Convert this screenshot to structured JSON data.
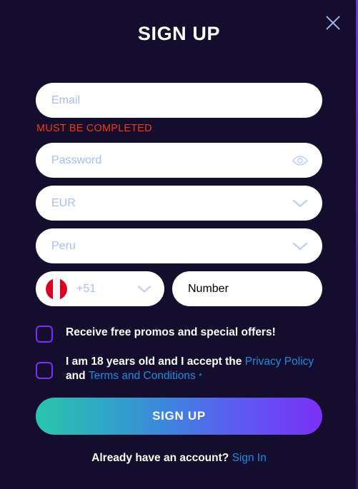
{
  "modal": {
    "title": "SIGN UP",
    "close_icon": "close-icon"
  },
  "form": {
    "email": {
      "placeholder": "Email",
      "value": "",
      "error": "MUST BE COMPLETED"
    },
    "password": {
      "placeholder": "Password",
      "value": "",
      "reveal_icon": "eye-icon"
    },
    "currency": {
      "value": "EUR",
      "chevron_icon": "chevron-down-icon"
    },
    "country": {
      "value": "Peru",
      "chevron_icon": "chevron-down-icon"
    },
    "phone": {
      "flag_icon": "peru-flag-icon",
      "dial_code": "+51",
      "chevron_icon": "chevron-down-icon",
      "number_placeholder": "Number",
      "number_value": ""
    }
  },
  "consents": {
    "promos": {
      "label": "Receive free promos and special offers!",
      "checked": false
    },
    "terms": {
      "prefix": "I am 18 years old and I accept the ",
      "privacy_link": "Privacy Policy",
      "conjunction": " and ",
      "terms_link": "Terms and Conditions",
      "required_mark": "*",
      "checked": false
    }
  },
  "actions": {
    "submit_label": "SIGN UP"
  },
  "footer": {
    "question": "Already have an account?",
    "signin_label": "Sign In"
  },
  "colors": {
    "background": "#150d2e",
    "accent_purple": "#7b2ff7",
    "accent_teal": "#2ac5ac",
    "link_blue": "#1b8ce3",
    "error_red": "#f03a17",
    "placeholder": "#a9bdf5",
    "flag_red": "#d80027"
  }
}
